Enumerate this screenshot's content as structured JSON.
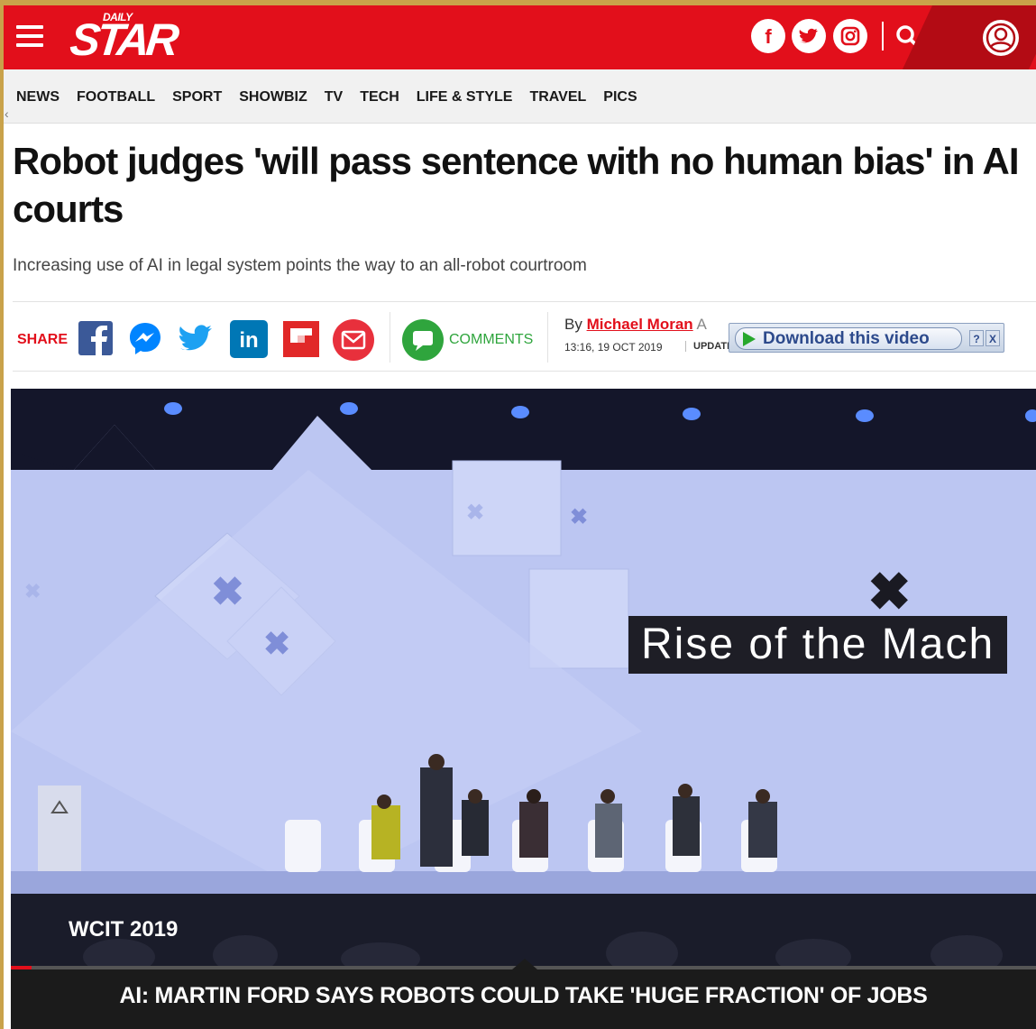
{
  "header": {
    "logo_small": "DAILY",
    "logo_main": "STAR",
    "social": {
      "facebook": "f",
      "twitter": "t",
      "instagram": "ig"
    }
  },
  "nav": {
    "items": [
      "NEWS",
      "FOOTBALL",
      "SPORT",
      "SHOWBIZ",
      "TV",
      "TECH",
      "LIFE & STYLE",
      "TRAVEL",
      "PICS"
    ],
    "scroll_left": "‹"
  },
  "article": {
    "headline": "Robot judges 'will pass sentence with no human bias' in AI courts",
    "subheadline": "Increasing use of AI in legal system points the way to an all-robot courtroom"
  },
  "share": {
    "label": "SHARE",
    "comments_label": "COMMENTS"
  },
  "byline": {
    "prefix": "By",
    "author": "Michael Moran",
    "role_fragment": "A",
    "timestamp": "13:16, 19 OCT 2019",
    "updated_label": "UPDATI"
  },
  "download_bar": {
    "label": "Download this video",
    "help": "?",
    "close": "X"
  },
  "video": {
    "screen_text": "Rise of the Mach",
    "event_label": "WCIT 2019",
    "caption": "AI: MARTIN FORD SAYS ROBOTS COULD TAKE 'HUGE FRACTION' OF JOBS",
    "progress_fraction": 0.02
  },
  "colors": {
    "brand_red": "#e20f1b",
    "comments_green": "#2fa53d",
    "download_blue": "#2d4a8c"
  }
}
